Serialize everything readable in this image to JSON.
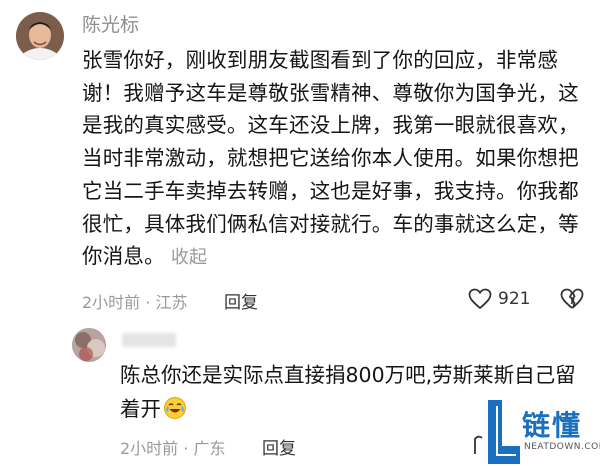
{
  "comment": {
    "author": "陈光标",
    "text": "张雪你好，刚收到朋友截图看到了你的回应，非常感谢！我赠予这车是尊敬张雪精神、尊敬你为国争光，这是我的真实感受。这车还没上牌，我第一眼就很喜欢，当时非常激动，就想把它送给你本人使用。如果你想把它当二手车卖掉去转赠，这也是好事，我支持。你我都很忙，具体我们俩私信对接就行。车的事就这么定，等你消息。",
    "collapse_label": "收起",
    "meta": "2小时前 · 江苏",
    "reply_label": "回复",
    "likes": "921"
  },
  "reply": {
    "text": "陈总你还是实际点直接捐800万吧,劳斯莱斯自己留着开",
    "meta": "2小时前 · 广东",
    "reply_label": "回复"
  },
  "watermark": {
    "brand": "链懂",
    "url": "NEATDOWN.COM"
  },
  "colors": {
    "meta": "#9a9a9a",
    "text": "#151515",
    "brand": "#1b6fc0"
  }
}
